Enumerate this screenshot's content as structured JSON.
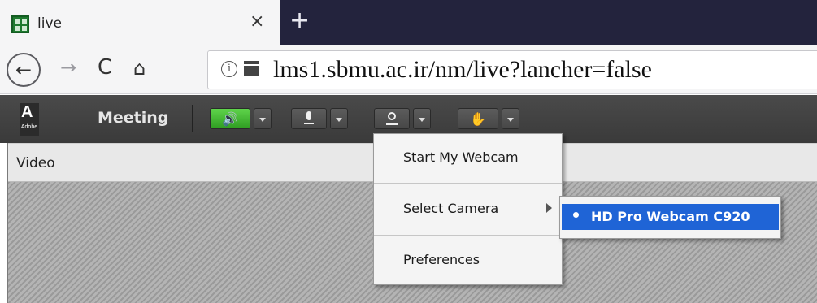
{
  "browser": {
    "tab": {
      "title": "live",
      "close_glyph": "×"
    },
    "new_tab_glyph": "+",
    "nav": {
      "back_glyph": "←",
      "forward_glyph": "→",
      "reload_glyph": "C",
      "home_glyph": "⌂"
    },
    "url": "lms1.sbmu.ac.ir/nm/live?lancher=false",
    "info_glyph": "i"
  },
  "connect": {
    "logo_word": "Adobe",
    "logo_mark": "A",
    "meeting_menu": "Meeting",
    "buttons": {
      "speaker": {
        "icon": "speaker-icon",
        "glyph": "🔊",
        "state": "on",
        "accent": "#3fb82d"
      },
      "microphone": {
        "icon": "microphone-icon"
      },
      "webcam": {
        "icon": "webcam-icon"
      },
      "raise_hand": {
        "icon": "raise-hand-icon",
        "glyph": "✋"
      }
    }
  },
  "pod": {
    "title": "Video"
  },
  "webcam_menu": {
    "items": [
      "Start My Webcam",
      "Select Camera",
      "Preferences"
    ],
    "camera_options": [
      {
        "label": "HD Pro Webcam C920",
        "selected": true
      }
    ],
    "highlight_color": "#1f64d6"
  }
}
